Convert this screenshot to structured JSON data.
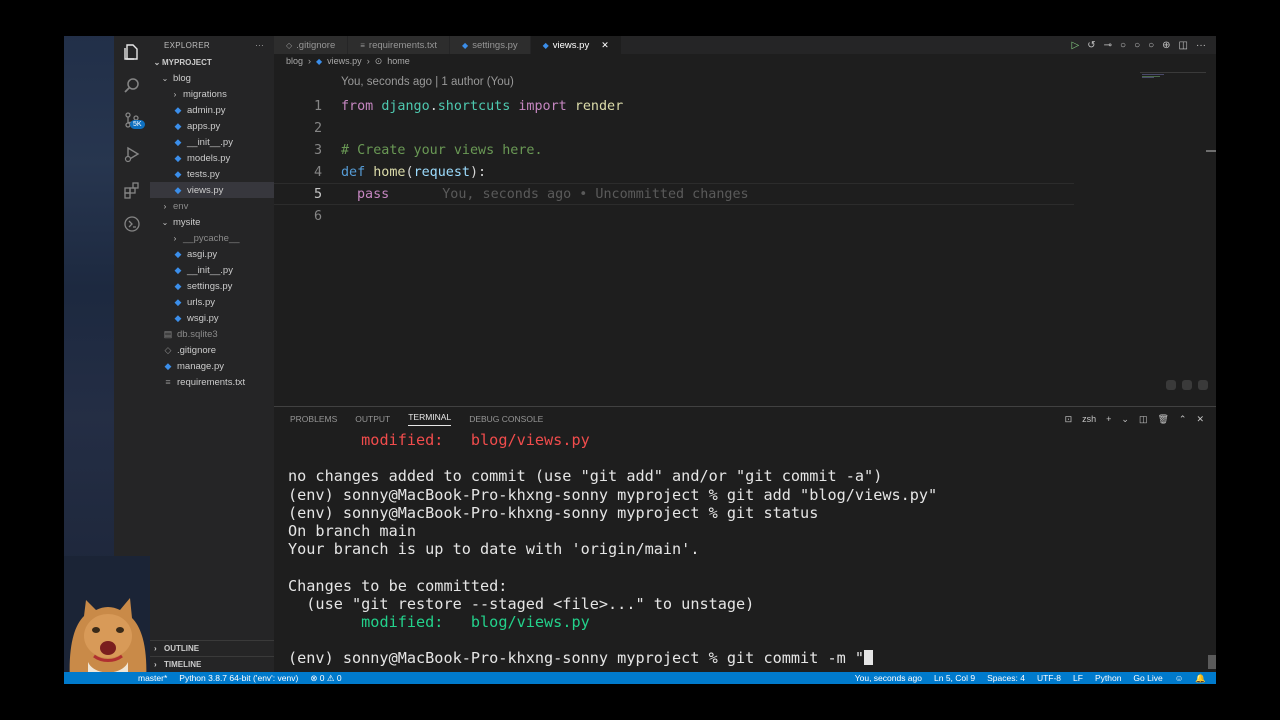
{
  "activity_bar": {
    "icons": [
      "files-icon",
      "search-icon",
      "source-control-icon",
      "run-debug-icon",
      "extensions-icon",
      "remote-icon"
    ],
    "scm_badge": "5K"
  },
  "explorer": {
    "title": "EXPLORER",
    "more": "···",
    "project": "MYPROJECT",
    "tree": [
      {
        "label": "blog",
        "indent": 1,
        "chev": "⌄",
        "icon": ""
      },
      {
        "label": "migrations",
        "indent": 2,
        "chev": "›",
        "icon": ""
      },
      {
        "label": "admin.py",
        "indent": 2,
        "chev": "",
        "icon": "py"
      },
      {
        "label": "apps.py",
        "indent": 2,
        "chev": "",
        "icon": "py"
      },
      {
        "label": "__init__.py",
        "indent": 2,
        "chev": "",
        "icon": "py"
      },
      {
        "label": "models.py",
        "indent": 2,
        "chev": "",
        "icon": "py"
      },
      {
        "label": "tests.py",
        "indent": 2,
        "chev": "",
        "icon": "py"
      },
      {
        "label": "views.py",
        "indent": 2,
        "chev": "",
        "icon": "py",
        "selected": true
      },
      {
        "label": "env",
        "indent": 1,
        "chev": "›",
        "icon": "",
        "muted": true
      },
      {
        "label": "mysite",
        "indent": 1,
        "chev": "⌄",
        "icon": ""
      },
      {
        "label": "__pycache__",
        "indent": 2,
        "chev": "›",
        "icon": "",
        "muted": true
      },
      {
        "label": "asgi.py",
        "indent": 2,
        "chev": "",
        "icon": "py"
      },
      {
        "label": "__init__.py",
        "indent": 2,
        "chev": "",
        "icon": "py"
      },
      {
        "label": "settings.py",
        "indent": 2,
        "chev": "",
        "icon": "py"
      },
      {
        "label": "urls.py",
        "indent": 2,
        "chev": "",
        "icon": "py"
      },
      {
        "label": "wsgi.py",
        "indent": 2,
        "chev": "",
        "icon": "py"
      },
      {
        "label": "db.sqlite3",
        "indent": 1,
        "chev": "",
        "icon": "db",
        "muted": true
      },
      {
        "label": ".gitignore",
        "indent": 1,
        "chev": "",
        "icon": "git"
      },
      {
        "label": "manage.py",
        "indent": 1,
        "chev": "",
        "icon": "py"
      },
      {
        "label": "requirements.txt",
        "indent": 1,
        "chev": "",
        "icon": "txt"
      }
    ],
    "outline": "OUTLINE",
    "timeline": "TIMELINE"
  },
  "tabs": [
    {
      "label": ".gitignore",
      "icon": "◇",
      "active": false
    },
    {
      "label": "requirements.txt",
      "icon": "≡",
      "active": false
    },
    {
      "label": "settings.py",
      "icon": "◆",
      "active": false
    },
    {
      "label": "views.py",
      "icon": "◆",
      "active": true,
      "close": "✕"
    }
  ],
  "breadcrumb": {
    "folder": "blog",
    "file": "views.py",
    "symbol": "home"
  },
  "blame": "You, seconds ago | 1 author (You)",
  "code": {
    "line_numbers": [
      "1",
      "2",
      "3",
      "4",
      "5",
      "6"
    ],
    "l1": {
      "kw": "from",
      "mod1": "django",
      "dot": ".",
      "mod2": "shortcuts",
      "kw2": "import",
      "name": "render"
    },
    "l3": {
      "comment": "# Create your views here."
    },
    "l4": {
      "kw": "def",
      "fn": "home",
      "open": "(",
      "param": "request",
      "close": "):"
    },
    "l5": {
      "kw": "pass",
      "annotation": "You, seconds ago • Uncommitted changes"
    }
  },
  "panel": {
    "tabs": [
      "PROBLEMS",
      "OUTPUT",
      "TERMINAL",
      "DEBUG CONSOLE"
    ],
    "active_tab": "TERMINAL",
    "shell": "zsh"
  },
  "terminal": {
    "modified_label": "modified:",
    "modified_file": "blog/views.py",
    "l_nochanges": "no changes added to commit (use \"git add\" and/or \"git commit -a\")",
    "l_add": "(env) sonny@MacBook-Pro-khxng-sonny myproject % git add \"blog/views.py\"",
    "l_status": "(env) sonny@MacBook-Pro-khxng-sonny myproject % git status",
    "l_branch": "On branch main",
    "l_uptodate": "Your branch is up to date with 'origin/main'.",
    "l_changes": "Changes to be committed:",
    "l_restore": "  (use \"git restore --staged <file>...\" to unstage)",
    "l_commit": "(env) sonny@MacBook-Pro-khxng-sonny myproject % git commit -m \""
  },
  "status": {
    "branch": "master*",
    "interpreter": "Python 3.8.7 64-bit ('env': venv)",
    "problems": "⊗ 0 ⚠ 0",
    "blame": "You, seconds ago",
    "position": "Ln 5, Col 9",
    "spaces": "Spaces: 4",
    "encoding": "UTF-8",
    "eol": "LF",
    "language": "Python",
    "golive": "Go Live"
  },
  "colors": {
    "statusbar": "#007acc",
    "accent": "#0e70c0"
  }
}
